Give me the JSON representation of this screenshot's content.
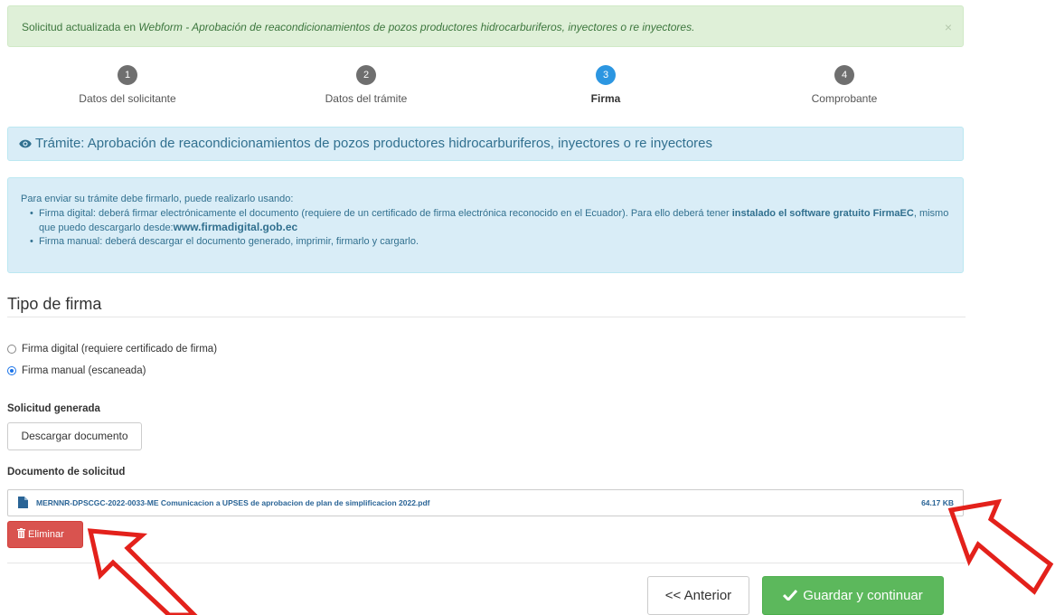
{
  "alert": {
    "prefix": "Solicitud actualizada en ",
    "emph": "Webform - Aprobación de reacondicionamientos de pozos productores hidrocarburiferos, inyectores o re inyectores.",
    "close": "×"
  },
  "steps": [
    {
      "num": "1",
      "label": "Datos del solicitante"
    },
    {
      "num": "2",
      "label": "Datos del trámite"
    },
    {
      "num": "3",
      "label": "Firma"
    },
    {
      "num": "4",
      "label": "Comprobante"
    }
  ],
  "tramite": {
    "text": "Trámite: Aprobación de reacondicionamientos de pozos productores hidrocarburiferos, inyectores o re inyectores"
  },
  "info": {
    "intro": "Para enviar su trámite debe firmarlo, puede realizarlo usando:",
    "item1_text": "Firma digital: deberá firmar electrónicamente el documento (requiere de un certificado de firma electrónica reconocido en el Ecuador). Para ello deberá tener ",
    "item1_bold": "instalado el software gratuito FirmaEC",
    "item1_mid": ", mismo que puedo descargarlo desde:",
    "item1_link": "www.firmadigital.gob.ec",
    "item2_text": "Firma manual: deberá descargar el documento generado, imprimir, firmarlo y cargarlo."
  },
  "firma": {
    "title": "Tipo de firma",
    "option_digital": "Firma digital (requiere certificado de firma)",
    "option_manual": "Firma manual (escaneada)"
  },
  "solicitud": {
    "label": "Solicitud generada",
    "download_button": "Descargar documento"
  },
  "documento": {
    "label": "Documento de solicitud",
    "file_name": "MERNNR-DPSCGC-2022-0033-ME Comunicacion a UPSES de aprobacion de plan de simplificacion 2022.pdf",
    "file_size": "64.17 KB",
    "delete_button": "Eliminar"
  },
  "nav": {
    "prev_button": "<< Anterior",
    "next_button": "Guardar y continuar"
  },
  "colors": {
    "success_bg": "#dff0d8",
    "info_bg": "#d9edf7",
    "step_active": "#2c96e1",
    "danger": "#d9534f",
    "success_btn": "#5cb85c",
    "arrow": "#e3211b"
  }
}
